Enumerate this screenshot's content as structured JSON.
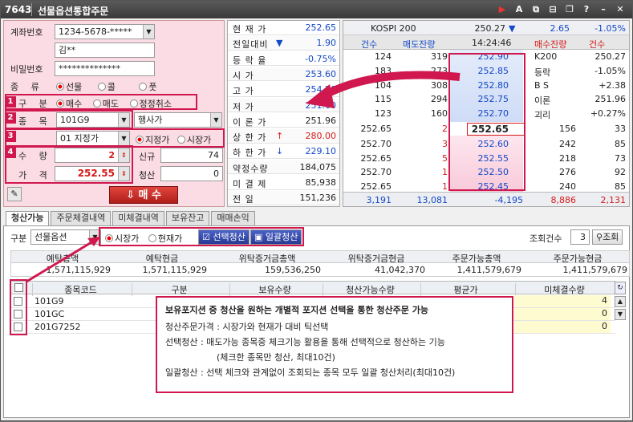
{
  "window": {
    "code": "7643",
    "title": "선물옵션통합주문",
    "icons": [
      "play-icon",
      "font-icon",
      "link-icon",
      "restore-icon",
      "copy-icon",
      "help-icon",
      "minimize-icon",
      "close-icon"
    ]
  },
  "order": {
    "account_label": "계좌번호",
    "account_value": "1234-5678-*****",
    "name_value": "김**",
    "password_label": "비밀번호",
    "password_value": "**************",
    "type_label": "종  류",
    "type_options": [
      "선물",
      "콜",
      "풋"
    ],
    "type_selected": "선물",
    "side_label": "구  분",
    "side_options": [
      "매수",
      "매도",
      "정정취소"
    ],
    "side_selected": "매수",
    "item_label": "종  목",
    "item_value": "101G9",
    "exercise_value": "행사가",
    "price_type_value": "01 지정가",
    "price_mode_options": [
      "지정가",
      "시장가"
    ],
    "price_mode_selected": "지정가",
    "qty_label": "수  량",
    "qty_value": "2",
    "price_label": "가  격",
    "price_value": "252.55",
    "new_label": "신규",
    "new_value": "74",
    "clear_label": "청산",
    "clear_value": "0",
    "buy_button": "매 수",
    "markers": [
      "1",
      "2",
      "3",
      "4"
    ]
  },
  "quote": {
    "rows": [
      {
        "k": "현 재 가",
        "v": "252.65",
        "a": "",
        "c": "blue"
      },
      {
        "k": "전일대비",
        "v": "1.90",
        "a": "▼",
        "c": "blue"
      },
      {
        "k": "등 락 율",
        "v": "-0.75%",
        "a": "",
        "c": "blue"
      },
      {
        "k": "시    가",
        "v": "253.60",
        "a": "",
        "c": "blue"
      },
      {
        "k": "고    가",
        "v": "254.20",
        "a": "",
        "c": "blue"
      },
      {
        "k": "저    가",
        "v": "251.60",
        "a": "",
        "c": "blue"
      },
      {
        "k": "이 론 가",
        "v": "251.96",
        "a": "",
        "c": "dark"
      },
      {
        "k": "상 한 가",
        "v": "280.00",
        "a": "↑",
        "c": "red"
      },
      {
        "k": "하 한 가",
        "v": "229.10",
        "a": "↓",
        "c": "blue"
      },
      {
        "k": "약정수량",
        "v": "184,075",
        "a": "",
        "c": "dark"
      },
      {
        "k": "미 결 제",
        "v": "85,938",
        "a": "",
        "c": "dark"
      },
      {
        "k": "전    일",
        "v": "151,236",
        "a": "",
        "c": "dark"
      }
    ]
  },
  "orderbook": {
    "kospi_label": "KOSPI 200",
    "kospi_value": "250.27",
    "kospi_change": "2.65",
    "kospi_rate": "-1.05%",
    "head": {
      "cnt": "건수",
      "ask_qty": "매도잔량",
      "time": "14:24:46",
      "bid_qty": "매수잔량",
      "bid_cnt": "건수"
    },
    "asks": [
      {
        "cnt": "124",
        "qty": "319",
        "price": "252.90"
      },
      {
        "cnt": "183",
        "qty": "273",
        "price": "252.85"
      },
      {
        "cnt": "104",
        "qty": "308",
        "price": "252.80"
      },
      {
        "cnt": "115",
        "qty": "294",
        "price": "252.75"
      },
      {
        "cnt": "123",
        "qty": "160",
        "price": "252.70"
      }
    ],
    "side_info": [
      {
        "k": "K200",
        "v": "250.27"
      },
      {
        "k": "등락",
        "v": "-1.05%"
      },
      {
        "k": "B S",
        "v": "+2.38"
      },
      {
        "k": "이론",
        "v": "251.96"
      },
      {
        "k": "괴리",
        "v": "+0.27%"
      }
    ],
    "current": "252.65",
    "bids": [
      {
        "ord": "252.70",
        "cnt": "3",
        "price": "252.60",
        "qty": "242",
        "bcnt": "85"
      },
      {
        "ord": "252.65",
        "cnt": "5",
        "price": "252.55",
        "qty": "218",
        "bcnt": "73"
      },
      {
        "ord": "252.70",
        "cnt": "1",
        "price": "252.50",
        "qty": "276",
        "bcnt": "92"
      },
      {
        "ord": "252.65",
        "cnt": "1",
        "price": "252.45",
        "qty": "240",
        "bcnt": "85"
      }
    ],
    "cur_row": {
      "ord": "252.65",
      "cnt": "2",
      "qty": "156",
      "bcnt": "33"
    },
    "foot": {
      "a": "3,191",
      "b": "13,081",
      "c": "-4,195",
      "d": "8,886",
      "e": "2,131"
    }
  },
  "tabs": [
    "청산가능",
    "주문체결내역",
    "미체결내역",
    "보유잔고",
    "매매손익"
  ],
  "bottom": {
    "kind_label": "구분",
    "kind_value": "선물옵션",
    "price_options": [
      "시장가",
      "현재가"
    ],
    "price_selected": "시장가",
    "select_clear": "선택청산",
    "batch_clear": "일괄청산",
    "count_label": "조회건수",
    "count_value": "3",
    "search_button": "조회",
    "summary_headers": [
      "예탁총액",
      "예탁현금",
      "위탁증거금총액",
      "위탁증거금현금",
      "주문가능총액",
      "주문가능현금"
    ],
    "summary_values": [
      "1,571,115,929",
      "1,571,115,929",
      "159,536,250",
      "41,042,370",
      "1,411,579,679",
      "1,411,579,679"
    ],
    "grid_headers": [
      "종목코드",
      "구분",
      "보유수량",
      "청산가능수량",
      "평균가",
      "미체결수량"
    ],
    "rows": [
      {
        "code": "101G9",
        "pending": "4"
      },
      {
        "code": "101GC",
        "pending": "0"
      },
      {
        "code": "201G7252",
        "pending": "0"
      }
    ]
  },
  "note": {
    "title": "보유포지션 중 청산을 원하는 개별적 포지션 선택을 통한 청산주문 가능",
    "line1": "청산주문가격 : 시장가와 현재가 대비 틱선택",
    "line2": "선택청산 : 매도가능 종목중 체크기능 활용을 통해 선택적으로 청산하는 기능",
    "line3": "(체크한 종목만 청산, 최대10건)",
    "line4": "일괄청산 : 선택 체크와 관계없이 조회되는 종목 모두 일괄 청산처리(최대10건)"
  }
}
